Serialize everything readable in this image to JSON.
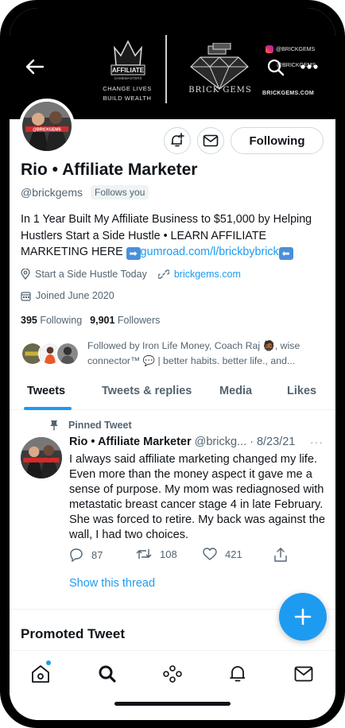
{
  "banner": {
    "affiliate_logo_text": "AFFILIATE",
    "affiliate_logo_subtext": "GAMEMASTERS",
    "affiliate_tagline_1": "CHANGE LIVES",
    "affiliate_tagline_2": "BUILD WEALTH",
    "brand_name": "BRICK GEMS",
    "instagram_handle": "@BRICKGEMS",
    "second_handle": "@BRICKGEMS",
    "website": "BRICKGEMS.COM"
  },
  "profile": {
    "name": "Rio • Affiliate Marketer",
    "handle": "@brickgems",
    "follows_you": "Follows you",
    "following_button": "Following",
    "avatar_caption": "@BRICKGEMS"
  },
  "bio": {
    "text_1": "In 1 Year Built My Affiliate Business to $51,000 by Helping Hustlers Start a Side Hustle • LEARN AFFILIATE MARKETING HERE ",
    "link": "gumroad.com/l/brickbybrick",
    "arrow_right": "➡",
    "arrow_left": "⬅"
  },
  "meta": {
    "location": "Start a Side Hustle Today",
    "website": "brickgems.com",
    "joined": "Joined June 2020"
  },
  "stats": {
    "following_count": "395",
    "following_label": "Following",
    "followers_count": "9,901",
    "followers_label": "Followers"
  },
  "followed_by": {
    "text": "Followed by Iron Life Money, Coach Raj 🧔🏾, wise connector™ 💬 | better habits. better life., and..."
  },
  "tabs": [
    {
      "label": "Tweets"
    },
    {
      "label": "Tweets & replies"
    },
    {
      "label": "Media"
    },
    {
      "label": "Likes"
    }
  ],
  "tweet": {
    "pinned_label": "Pinned Tweet",
    "author_name": "Rio • Affiliate Marketer",
    "author_handle": "@brickg...",
    "date": "· 8/23/21",
    "body": "I always said affiliate marketing changed my life. Even more than the money aspect it gave me a sense of purpose. My mom was rediagnosed with metastatic breast cancer stage 4 in late February. She was forced to retire. My back was against the wall, I had two choices.",
    "replies": "87",
    "retweets": "108",
    "likes": "421",
    "show_thread": "Show this thread",
    "more_dots": "···"
  },
  "promoted": {
    "label": "Promoted Tweet"
  },
  "colors": {
    "accent": "#1d9bf0",
    "text_primary": "#0f1419",
    "text_secondary": "#536471"
  },
  "icons": {
    "back": "back-arrow-icon",
    "search": "search-icon",
    "more": "more-dots-icon",
    "notify": "bell-plus-icon",
    "message": "mail-icon",
    "location": "location-pin-icon",
    "link": "link-icon",
    "calendar": "calendar-icon",
    "pin": "pin-icon",
    "reply": "reply-icon",
    "retweet": "retweet-icon",
    "like": "heart-icon",
    "share": "share-icon",
    "compose": "plus-icon",
    "nav_home": "home-icon",
    "nav_search": "search-icon",
    "nav_spaces": "spaces-icon",
    "nav_notifications": "bell-icon",
    "nav_messages": "mail-icon"
  }
}
